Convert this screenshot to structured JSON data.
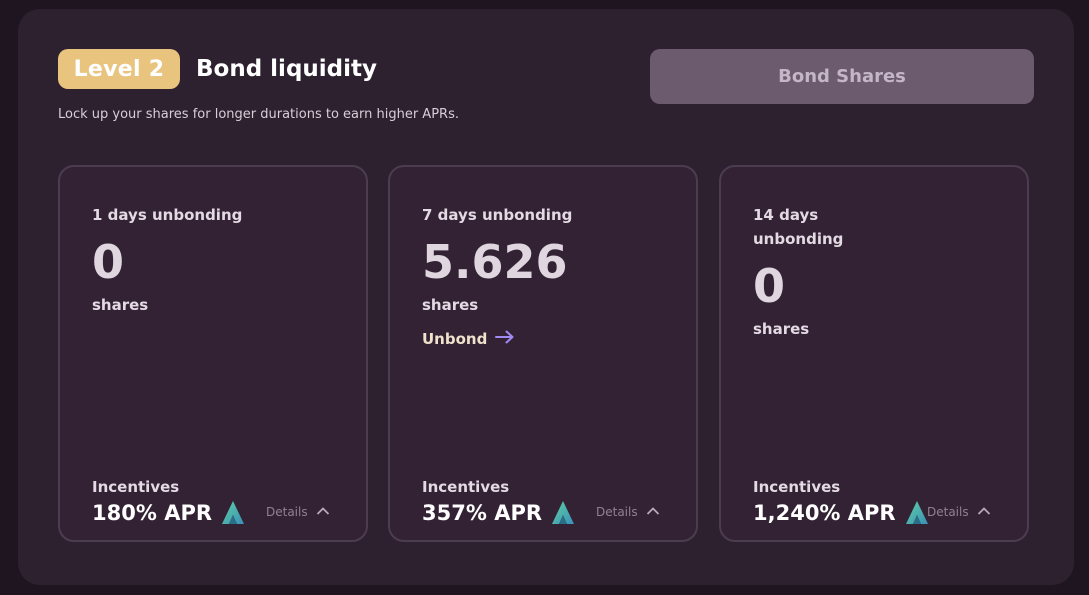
{
  "header": {
    "level_badge": "Level 2",
    "title": "Bond liquidity",
    "subtitle": "Lock up your shares for longer durations to earn higher APRs.",
    "bond_button": "Bond Shares"
  },
  "cards": [
    {
      "duration": "1 days unbonding",
      "amount": "0",
      "unit": "shares",
      "incentives_label": "Incentives",
      "apr": "180% APR",
      "token_icon": "teal-arrow-token-icon",
      "details_label": "Details"
    },
    {
      "duration": "7 days unbonding",
      "amount": "5.626",
      "unit": "shares",
      "unbond_label": "Unbond",
      "incentives_label": "Incentives",
      "apr": "357% APR",
      "token_icon": "teal-arrow-token-icon",
      "details_label": "Details"
    },
    {
      "duration": "14 days unbonding",
      "amount": "0",
      "unit": "shares",
      "incentives_label": "Incentives",
      "apr": "1,240% APR",
      "token_icon": "teal-arrow-token-icon",
      "details_label": "Details"
    }
  ],
  "colors": {
    "background": "#1f1520",
    "panel": "#2d2130",
    "card": "#332234",
    "badge": "#e8c47f",
    "button": "#6c5a6e",
    "unbond_arrow": "#a28bf0"
  }
}
